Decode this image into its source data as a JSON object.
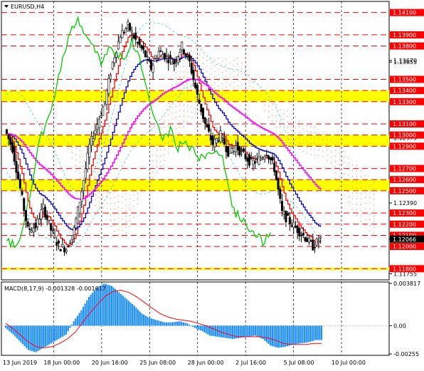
{
  "window": {
    "symbol_caption": "EURUSD,H4",
    "menu_icon": "triangle-down-icon"
  },
  "price_axis": {
    "range": [
      1.117,
      1.142
    ],
    "ticks": [
      {
        "label": "1.13670",
        "value": 1.1367
      },
      {
        "label": "1.13655",
        "value": 1.13655
      },
      {
        "label": "1.12975",
        "value": 1.12975
      },
      {
        "label": "1.12390",
        "value": 1.1239
      },
      {
        "label": "1.12065",
        "value": 1.12065
      },
      {
        "label": "1.11755",
        "value": 1.11755
      }
    ],
    "boxed_levels": [
      {
        "label": "1.14100",
        "value": 1.141,
        "color": "#ff0000"
      },
      {
        "label": "1.13900",
        "value": 1.139,
        "color": "#ff0000"
      },
      {
        "label": "1.13800",
        "value": 1.138,
        "color": "#ff0000"
      },
      {
        "label": "1.13500",
        "value": 1.135,
        "color": "#ff0000"
      },
      {
        "label": "1.13400",
        "value": 1.134,
        "color": "#ff0000"
      },
      {
        "label": "1.13300",
        "value": 1.133,
        "color": "#ff0000"
      },
      {
        "label": "1.13100",
        "value": 1.131,
        "color": "#ff0000"
      },
      {
        "label": "1.13000",
        "value": 1.13,
        "color": "#ff0000"
      },
      {
        "label": "1.12900",
        "value": 1.129,
        "color": "#ff0000"
      },
      {
        "label": "1.12700",
        "value": 1.127,
        "color": "#ff0000"
      },
      {
        "label": "1.12600",
        "value": 1.126,
        "color": "#ff0000"
      },
      {
        "label": "1.12500",
        "value": 1.125,
        "color": "#ff0000"
      },
      {
        "label": "1.12300",
        "value": 1.123,
        "color": "#ff0000"
      },
      {
        "label": "1.12200",
        "value": 1.122,
        "color": "#ff0000"
      },
      {
        "label": "1.12100",
        "value": 1.121,
        "color": "#ff0000"
      },
      {
        "label": "1.12066",
        "value": 1.12066,
        "color": "#000000"
      },
      {
        "label": "1.12000",
        "value": 1.12,
        "color": "#ff0000"
      },
      {
        "label": "1.11800",
        "value": 1.118,
        "color": "#ff0000"
      }
    ],
    "zones": [
      {
        "from": 1.133,
        "to": 1.134,
        "color": "#ffff00"
      },
      {
        "from": 1.129,
        "to": 1.13,
        "color": "#ffff00"
      },
      {
        "from": 1.125,
        "to": 1.126,
        "color": "#ffff00"
      },
      {
        "from": 1.1179,
        "to": 1.1181,
        "color": "#ffff00"
      }
    ]
  },
  "time_axis": {
    "labels": [
      "13 Jun 2019",
      "18 Jun 00:00",
      "20 Jun 16:00",
      "25 Jun 08:00",
      "28 Jun 00:00",
      "2 Jul 16:00",
      "5 Jul 08:00",
      "10 Jul 00:00"
    ]
  },
  "macd": {
    "caption": "MACD(8,17,9) -0.001328 -0.001617",
    "axis_labels": [
      {
        "label": "0.003817",
        "value": 0.003817
      },
      {
        "label": "0.00",
        "value": 0.0
      },
      {
        "label": "-0.00255",
        "value": -0.00255
      }
    ],
    "histogram_color": "#1e90ff",
    "signal_color": "#ff0000"
  },
  "colors": {
    "candles": "#000000",
    "short_ma": "#ff0000",
    "medium_ma": "#0000cd",
    "long_ma": "#ff00ff",
    "lagging_line": "#00cc00",
    "cloud_dots": "#e08a50",
    "channel": "#40d0d0",
    "level_lines": "#ff0000",
    "zone_fill": "#ffff00"
  },
  "chart_data": {
    "type": "candlestick",
    "x": [
      "13 Jun 2019",
      "18 Jun 00:00",
      "20 Jun 16:00",
      "25 Jun 08:00",
      "28 Jun 00:00",
      "2 Jul 16:00",
      "5 Jul 08:00",
      "10 Jul 00:00"
    ],
    "ylim": [
      1.117,
      1.142
    ],
    "last_price": 1.12066,
    "price_path": [
      1.1305,
      1.1288,
      1.1252,
      1.1215,
      1.1218,
      1.1235,
      1.1215,
      1.12,
      1.1198,
      1.1215,
      1.125,
      1.129,
      1.131,
      1.133,
      1.1365,
      1.139,
      1.1398,
      1.1385,
      1.1375,
      1.136,
      1.1375,
      1.137,
      1.1365,
      1.138,
      1.1365,
      1.1335,
      1.131,
      1.1292,
      1.13,
      1.1285,
      1.129,
      1.1282,
      1.1275,
      1.1278,
      1.1285,
      1.127,
      1.123,
      1.1222,
      1.1215,
      1.1208,
      1.12,
      1.1207
    ],
    "macd": {
      "ylim": [
        -0.00255,
        0.003817
      ],
      "histogram": [
        -0.0002,
        -0.0008,
        -0.0015,
        -0.0022,
        -0.0024,
        -0.002,
        -0.0016,
        -0.0012,
        -0.0008,
        0.0004,
        0.0014,
        0.0026,
        0.0034,
        0.0038,
        0.0036,
        0.003,
        0.0024,
        0.0018,
        0.0011,
        0.0007,
        0.0005,
        0.0003,
        0.0003,
        0.0004,
        0.0002,
        -0.0002,
        -0.0005,
        -0.0009,
        -0.001,
        -0.0011,
        -0.0012,
        -0.0011,
        -0.001,
        -0.0009,
        -0.0012,
        -0.0018,
        -0.002,
        -0.0019,
        -0.0017,
        -0.0016,
        -0.0015,
        -0.0013
      ],
      "signal": [
        0.0002,
        -0.0003,
        -0.0009,
        -0.0015,
        -0.0019,
        -0.002,
        -0.0019,
        -0.0016,
        -0.0012,
        -0.0006,
        0.0003,
        0.0012,
        0.002,
        0.0027,
        0.0031,
        0.0032,
        0.003,
        0.0026,
        0.0021,
        0.0016,
        0.0011,
        0.0008,
        0.0006,
        0.0005,
        0.0004,
        0.0002,
        0.0,
        -0.0003,
        -0.0006,
        -0.0008,
        -0.001,
        -0.001,
        -0.001,
        -0.001,
        -0.0011,
        -0.0013,
        -0.0016,
        -0.0017,
        -0.0017,
        -0.0017,
        -0.0016,
        -0.0016
      ]
    }
  }
}
